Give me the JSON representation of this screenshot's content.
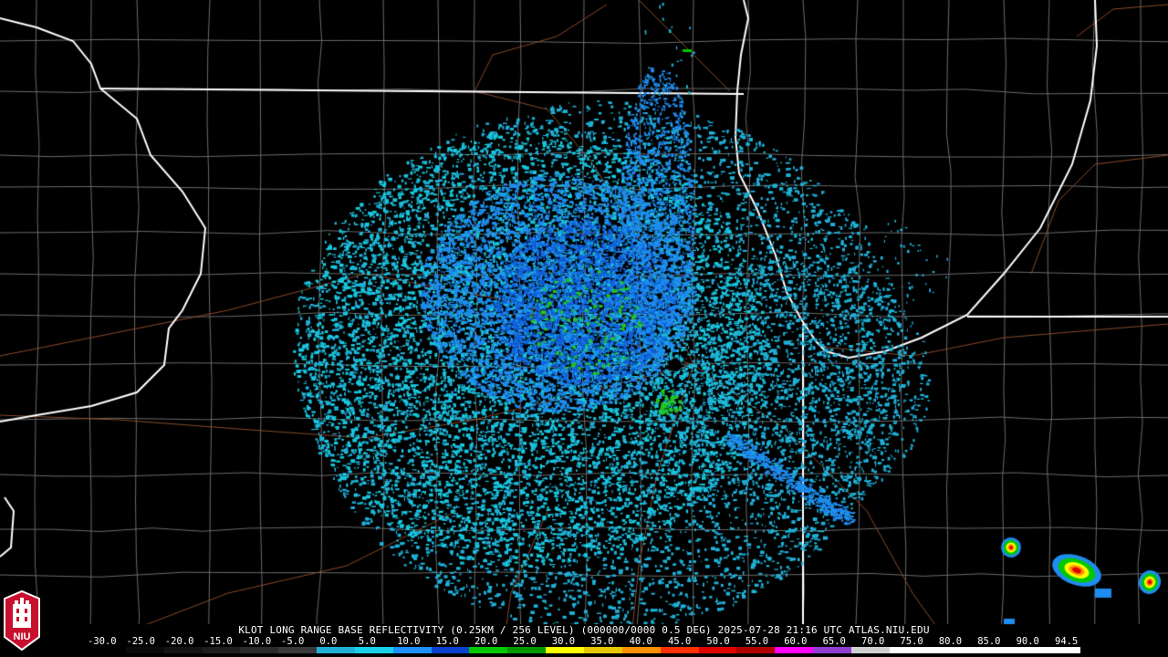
{
  "product": {
    "title": "KLOT LONG RANGE BASE REFLECTIVITY (0.25KM / 256 LEVEL) (000000/0000 0.5 DEG) 2025-07-28 21:16 UTC  ATLAS.NIU.EDU"
  },
  "colorbar": {
    "tick_labels": [
      "-30.0",
      "-25.0",
      "-20.0",
      "-15.0",
      "-10.0",
      "-5.0",
      "0.0",
      "5.0",
      "10.0",
      "15.0",
      "20.0",
      "25.0",
      "30.0",
      "35.0",
      "40.0",
      "45.0",
      "50.0",
      "55.0",
      "60.0",
      "65.0",
      "70.0",
      "75.0",
      "80.0",
      "85.0",
      "90.0",
      "94.5"
    ],
    "colors": [
      "#000000",
      "#0a0a0a",
      "#141414",
      "#1e1e1e",
      "#2a2a2a",
      "#3a3a3a",
      "#1fb0d8",
      "#18d0e8",
      "#1e90ff",
      "#0a40d0",
      "#00c800",
      "#009a00",
      "#ffff00",
      "#e8c800",
      "#ff9000",
      "#ff3000",
      "#e00000",
      "#b00000",
      "#ff00ff",
      "#9040d0",
      "#d0d0d0",
      "#ffffff",
      "#ffffff",
      "#ffffff",
      "#ffffff",
      "#ffffff"
    ]
  },
  "logo": {
    "text": "NIU",
    "color": "#c8102e"
  },
  "radar": {
    "site": "KLOT"
  }
}
